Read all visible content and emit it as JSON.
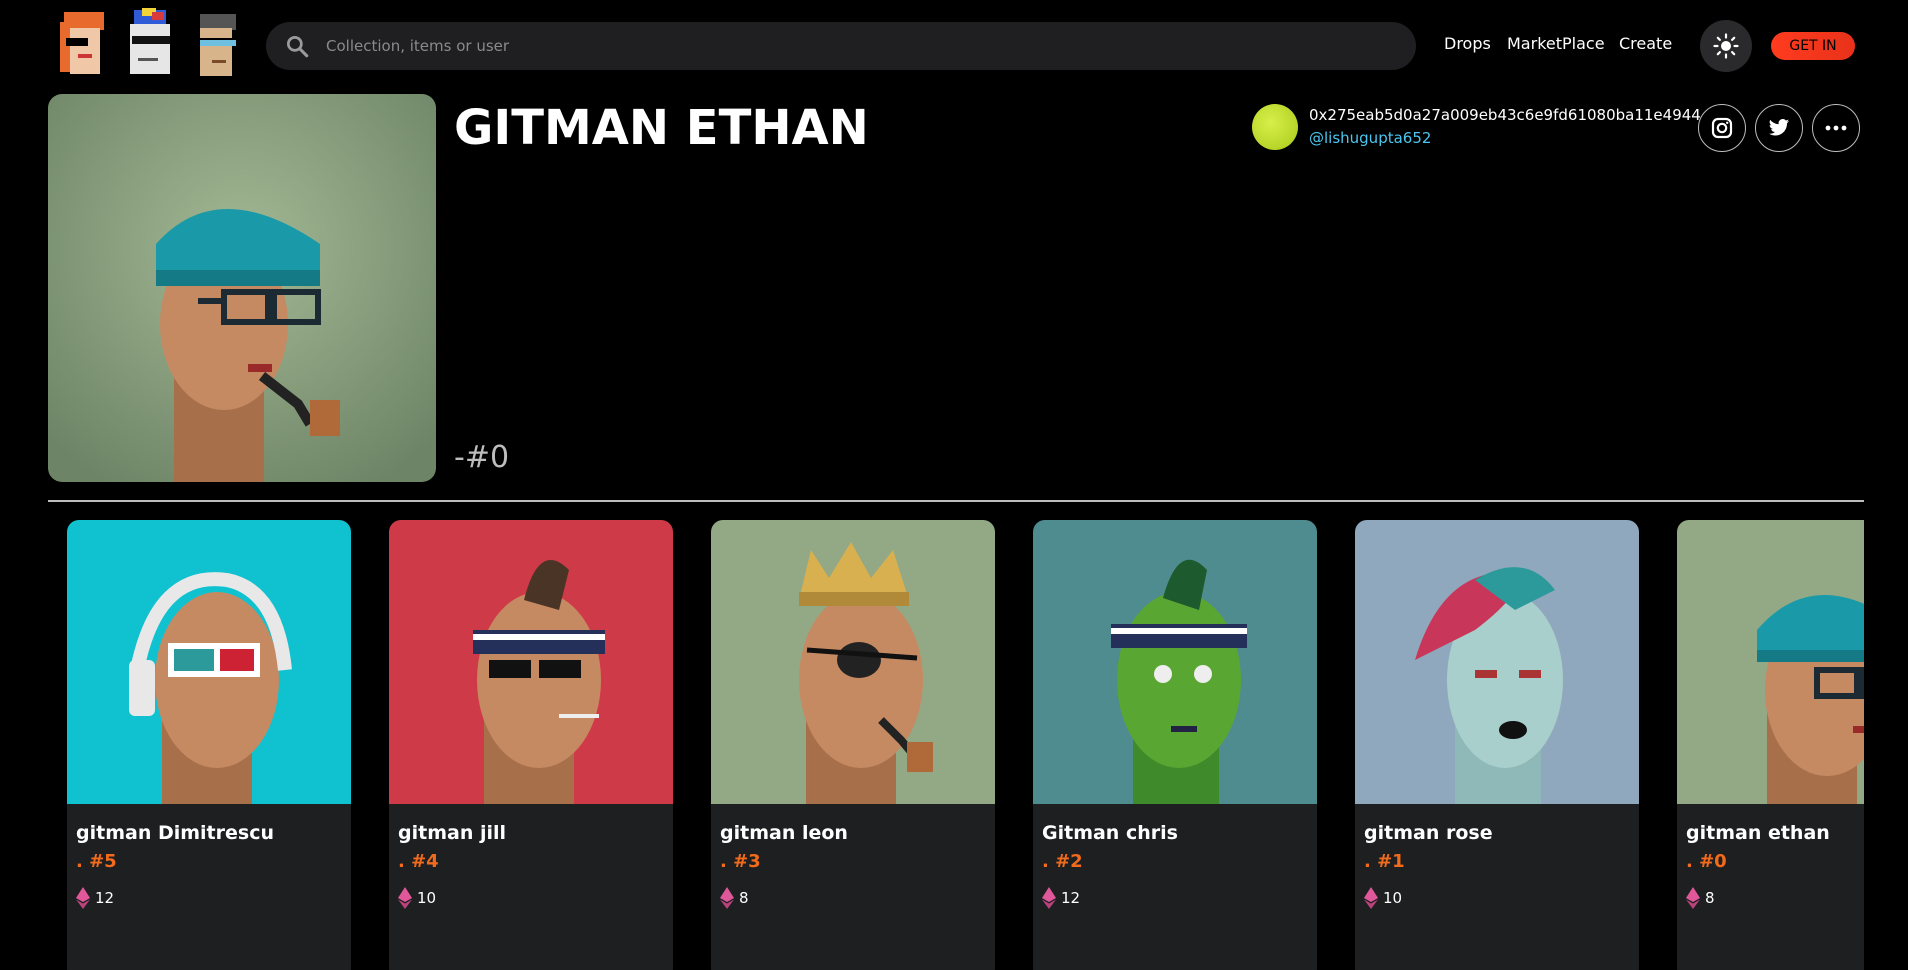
{
  "header": {
    "search_placeholder": "Collection, items or user",
    "nav": [
      "Drops",
      "MarketPlace",
      "Create"
    ],
    "get_in_label": "GET IN"
  },
  "hero": {
    "title": "GITMAN ETHAN",
    "number": "-#0",
    "owner_address": "0x275eab5d0a27a009eb43c6e9fd61080ba11e4944",
    "owner_handle": "@lishugupta652"
  },
  "colors": {
    "accent": "#f26a1b",
    "button": "#ff3b1f",
    "link": "#4cc6ef"
  },
  "cards": [
    {
      "name": "gitman Dimitrescu",
      "number": ". #5",
      "price": "12",
      "bg": "#10c2cf"
    },
    {
      "name": "gitman jill",
      "number": ". #4",
      "price": "10",
      "bg": "#cf3a48"
    },
    {
      "name": "gitman leon",
      "number": ". #3",
      "price": "8",
      "bg": "#93a885"
    },
    {
      "name": "Gitman chris",
      "number": ". #2",
      "price": "12",
      "bg": "#4f8c90"
    },
    {
      "name": "gitman rose",
      "number": ". #1",
      "price": "10",
      "bg": "#8fa8bd"
    },
    {
      "name": "gitman ethan",
      "number": ". #0",
      "price": "8",
      "bg": "#93a885"
    }
  ]
}
